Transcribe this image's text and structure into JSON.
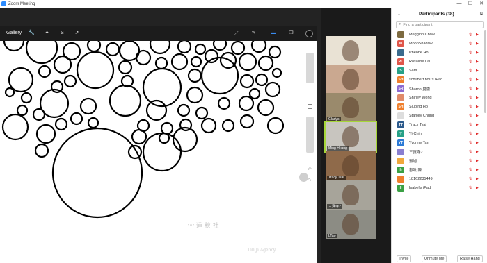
{
  "window": {
    "title": "Zoom Meeting",
    "controls": [
      "—",
      "☐",
      "✕"
    ]
  },
  "share": {
    "gallery_label": "Gallery",
    "left_tools": [
      "🔧",
      "✦",
      "S",
      "➚"
    ],
    "right_tools": [
      "／",
      "✎",
      "▬",
      "❐"
    ],
    "undo": "↶",
    "redo": "↷"
  },
  "video_tiles": [
    {
      "name": "",
      "bg": "#e9e2d4"
    },
    {
      "name": "",
      "bg": "#caa890"
    },
    {
      "name": "Gladys",
      "bg": "#9a8a6c"
    },
    {
      "name": "Ming Huang",
      "bg": "#c8c5bf",
      "active": true
    },
    {
      "name": "Tracy Tsai",
      "bg": "#8f6a4a"
    },
    {
      "name": "三寶寺2",
      "bg": "#a7a49a"
    },
    {
      "name": "LTao",
      "bg": "#8c8c84"
    }
  ],
  "panel": {
    "title": "Participants (38)",
    "search_placeholder": "Find a participant",
    "participants": [
      {
        "initials": "",
        "name": "Megginn Chow",
        "color": "#7d6a40",
        "icon": true
      },
      {
        "initials": "M",
        "name": "MoonShadow",
        "color": "#e0564a"
      },
      {
        "initials": "",
        "name": "Pheobe Ho",
        "color": "#3a6a8c",
        "icon": true
      },
      {
        "initials": "RL",
        "name": "Rosaline Lau",
        "color": "#e0564a"
      },
      {
        "initials": "S",
        "name": "Sam",
        "color": "#27a187"
      },
      {
        "initials": "SH",
        "name": "schubert hou's iPad",
        "color": "#f07f2c"
      },
      {
        "initials": "SR",
        "name": "Sharon 夏蕾",
        "color": "#8c6ad1"
      },
      {
        "initials": "",
        "name": "Shirley Wong",
        "color": "#e08a6a",
        "icon": true
      },
      {
        "initials": "SH",
        "name": "Siuping Ho",
        "color": "#f07f2c"
      },
      {
        "initials": "",
        "name": "Stanley Chung",
        "color": "#dddddd",
        "icon": true
      },
      {
        "initials": "TT",
        "name": "Tracy Tsai",
        "color": "#2c5a8c"
      },
      {
        "initials": "Y",
        "name": "Yi-Chin",
        "color": "#27a187"
      },
      {
        "initials": "YT",
        "name": "Yvonne Tan",
        "color": "#2c7ad6"
      },
      {
        "initials": "",
        "name": "三寶寺2",
        "color": "#8a7fd0",
        "icon": true
      },
      {
        "initials": "",
        "name": "淑旭",
        "color": "#f0a83c",
        "icon": true
      },
      {
        "initials": "h",
        "name": "惠眩 陳",
        "color": "#3aa044"
      },
      {
        "initials": "",
        "name": "18162235449",
        "color": "#f07f2c",
        "icon": true
      },
      {
        "initials": "II",
        "name": "Isabel's iPad",
        "color": "#3aa044"
      }
    ],
    "buttons": {
      "invite": "Invite",
      "unmute": "Unmute Me",
      "raise": "Raise Hand"
    }
  },
  "watermark": {
    "main": "〰 道 秋 社",
    "sub": "Lili Ji Agency"
  }
}
